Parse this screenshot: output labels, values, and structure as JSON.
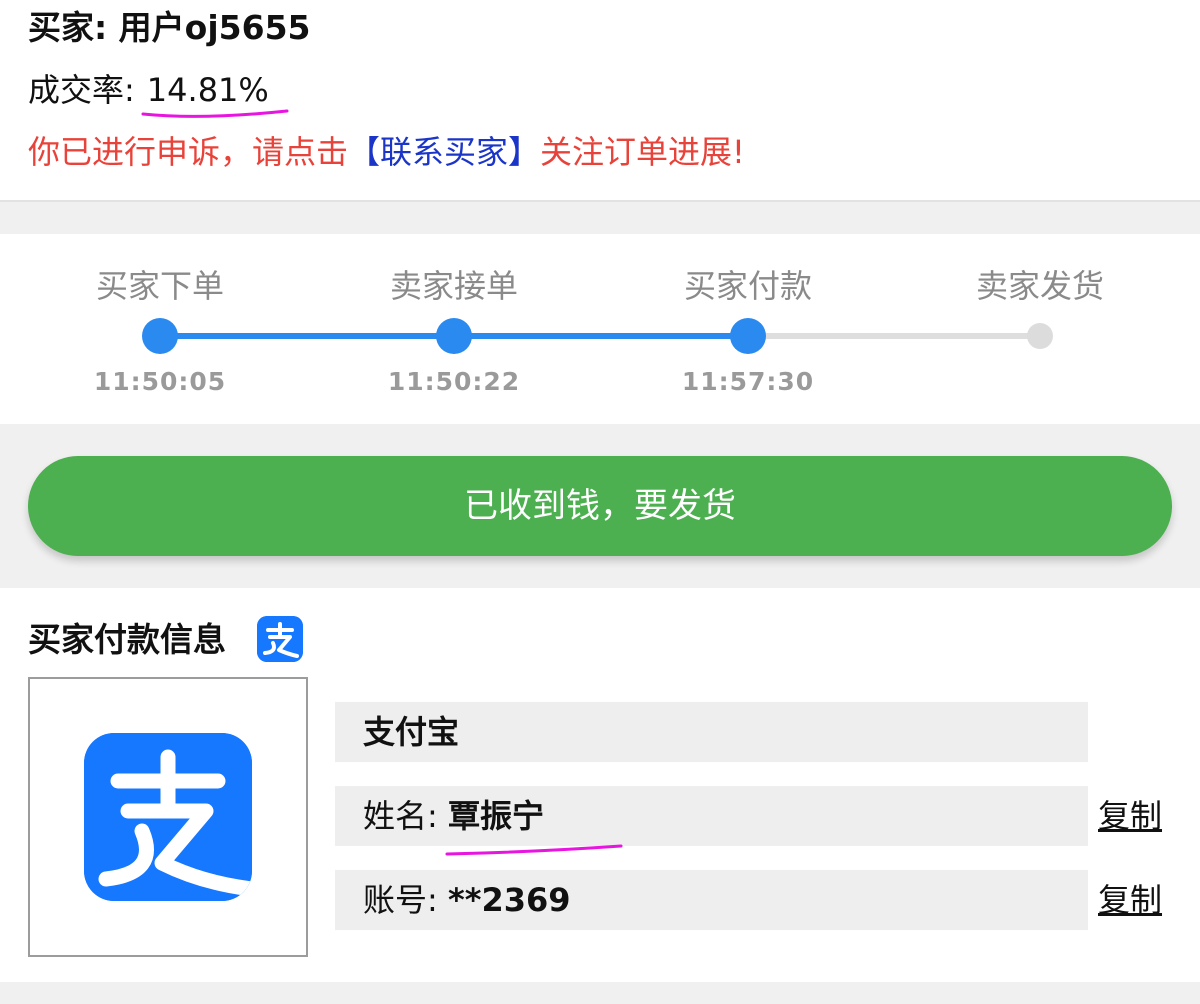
{
  "buyer": {
    "name_label": "买家: 用户oj5655",
    "rate_label": "成交率:",
    "rate_value": "14.81%",
    "appeal_prefix": "你已进行申诉，请点击",
    "appeal_link": "【联系买家】",
    "appeal_suffix": "关注订单进展!"
  },
  "progress": {
    "steps": [
      {
        "label": "买家下单",
        "time": "11:50:05",
        "status": "done"
      },
      {
        "label": "卖家接单",
        "time": "11:50:22",
        "status": "done"
      },
      {
        "label": "买家付款",
        "time": "11:57:30",
        "status": "done"
      },
      {
        "label": "卖家发货",
        "time": "",
        "status": "pending"
      }
    ]
  },
  "action": {
    "button_label": "已收到钱，要发货"
  },
  "payment": {
    "title": "买家付款信息",
    "method": "支付宝",
    "name_label": "姓名:",
    "name_value": "覃振宁",
    "account_label": "账号:",
    "account_value": "**2369",
    "copy_label": "复制",
    "icon": "alipay-icon"
  },
  "colors": {
    "accent_blue": "#2b8af0",
    "alipay_blue": "#1677ff",
    "button_green": "#4caf50",
    "warning_red": "#e8433a",
    "link_blue": "#1a35c8",
    "highlight_magenta": "#e815e0"
  }
}
